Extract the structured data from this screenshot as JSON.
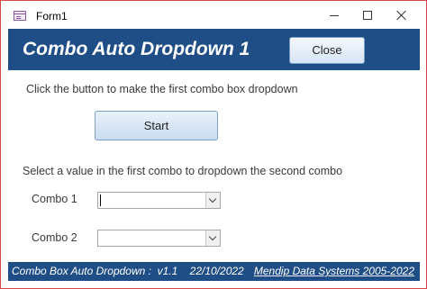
{
  "window": {
    "title": "Form1",
    "icon": "access-form-icon",
    "controls": [
      "minimize-icon",
      "maximize-icon",
      "close-icon"
    ]
  },
  "header": {
    "title": "Combo Auto Dropdown 1",
    "close_label": "Close",
    "background_color": "#1f4e86"
  },
  "main": {
    "instruction_1": "Click the button to make the first combo box dropdown",
    "start_label": "Start",
    "instruction_2": "Select a value in the first combo to dropdown the second combo",
    "combo1": {
      "label": "Combo 1",
      "value": ""
    },
    "combo2": {
      "label": "Combo 2",
      "value": ""
    }
  },
  "footer": {
    "version_text": "Combo Box Auto Dropdown :  v1.1    22/10/2022",
    "link_text": "Mendip Data Systems 2005-2022"
  }
}
